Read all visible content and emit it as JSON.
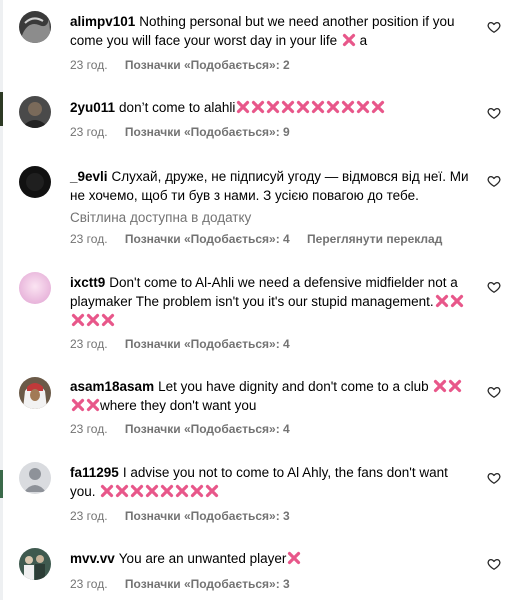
{
  "comments": [
    {
      "username": "alimpv101",
      "text": "Nothing personal but we need another position if you come you will face your worst day in your life",
      "emojis_before": 1,
      "suffix": "a",
      "time": "23 год.",
      "likes": "Позначки «Подобається»: 2",
      "avatar_icon": "dark-profile-photo"
    },
    {
      "username": "2yu011",
      "text": "don’t come to alahli",
      "emojis_after": 10,
      "time": "23 год.",
      "likes": "Позначки «Подобається»: 9",
      "avatar_icon": "dark-profile-photo"
    },
    {
      "username": "_9evli",
      "text": "Слухай, друже, не підписуй угоду — відмовся від неї. Ми не хочемо, щоб ти був з нами. З усією повагою до тебе.",
      "photo_note": "Світлина доступна в додатку",
      "time": "23 год.",
      "likes": "Позначки «Подобається»: 4",
      "translate": "Переглянути переклад",
      "avatar_icon": "black-profile-photo"
    },
    {
      "username": "ixctt9",
      "text": "Don't come to Al-Ahli we need a defensive midfielder not a playmaker The problem isn't you it's our stupid management.",
      "emojis_after": 5,
      "time": "23 год.",
      "likes": "Позначки «Подобається»: 4",
      "avatar_icon": "pink-gradient-avatar"
    },
    {
      "username": "asam18asam",
      "text_before": "Let you have dignity and don't come to a club",
      "emojis_mid": 4,
      "text_after": "where they don't want you",
      "time": "23 год.",
      "likes": "Позначки «Подобається»: 4",
      "avatar_icon": "person-in-ghutra-photo"
    },
    {
      "username": "fa11295",
      "text": "I advise you not to come to Al Ahly, the fans don't want you.",
      "emojis_after": 8,
      "time": "23 год.",
      "likes": "Позначки «Подобається»: 3",
      "avatar_icon": "default-user-avatar"
    },
    {
      "username": "mvv.vv",
      "text": "You are an unwanted player",
      "emojis_after": 1,
      "time": "23 год.",
      "likes": "Позначки «Подобається»: 3",
      "avatar_icon": "group-photo-avatar"
    }
  ],
  "colors": {
    "emoji_x": "#e8578a",
    "meta_text": "#737373",
    "heart_stroke": "#262626"
  },
  "icons": [
    "heart-icon",
    "cross-mark-emoji"
  ]
}
